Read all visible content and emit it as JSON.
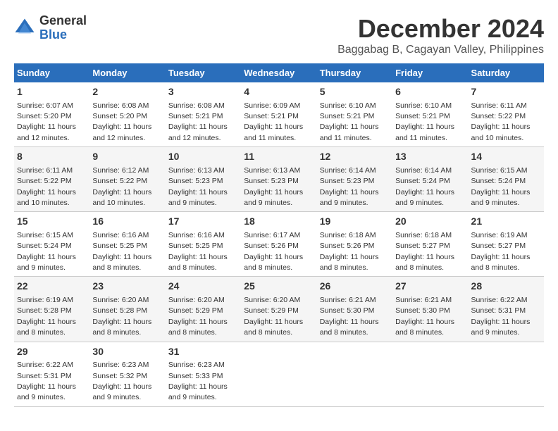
{
  "logo": {
    "general": "General",
    "blue": "Blue"
  },
  "title": "December 2024",
  "subtitle": "Baggabag B, Cagayan Valley, Philippines",
  "days": [
    "Sunday",
    "Monday",
    "Tuesday",
    "Wednesday",
    "Thursday",
    "Friday",
    "Saturday"
  ],
  "weeks": [
    [
      {
        "day": "1",
        "sunrise": "Sunrise: 6:07 AM",
        "sunset": "Sunset: 5:20 PM",
        "daylight": "Daylight: 11 hours and 12 minutes."
      },
      {
        "day": "2",
        "sunrise": "Sunrise: 6:08 AM",
        "sunset": "Sunset: 5:20 PM",
        "daylight": "Daylight: 11 hours and 12 minutes."
      },
      {
        "day": "3",
        "sunrise": "Sunrise: 6:08 AM",
        "sunset": "Sunset: 5:21 PM",
        "daylight": "Daylight: 11 hours and 12 minutes."
      },
      {
        "day": "4",
        "sunrise": "Sunrise: 6:09 AM",
        "sunset": "Sunset: 5:21 PM",
        "daylight": "Daylight: 11 hours and 11 minutes."
      },
      {
        "day": "5",
        "sunrise": "Sunrise: 6:10 AM",
        "sunset": "Sunset: 5:21 PM",
        "daylight": "Daylight: 11 hours and 11 minutes."
      },
      {
        "day": "6",
        "sunrise": "Sunrise: 6:10 AM",
        "sunset": "Sunset: 5:21 PM",
        "daylight": "Daylight: 11 hours and 11 minutes."
      },
      {
        "day": "7",
        "sunrise": "Sunrise: 6:11 AM",
        "sunset": "Sunset: 5:22 PM",
        "daylight": "Daylight: 11 hours and 10 minutes."
      }
    ],
    [
      {
        "day": "8",
        "sunrise": "Sunrise: 6:11 AM",
        "sunset": "Sunset: 5:22 PM",
        "daylight": "Daylight: 11 hours and 10 minutes."
      },
      {
        "day": "9",
        "sunrise": "Sunrise: 6:12 AM",
        "sunset": "Sunset: 5:22 PM",
        "daylight": "Daylight: 11 hours and 10 minutes."
      },
      {
        "day": "10",
        "sunrise": "Sunrise: 6:13 AM",
        "sunset": "Sunset: 5:23 PM",
        "daylight": "Daylight: 11 hours and 9 minutes."
      },
      {
        "day": "11",
        "sunrise": "Sunrise: 6:13 AM",
        "sunset": "Sunset: 5:23 PM",
        "daylight": "Daylight: 11 hours and 9 minutes."
      },
      {
        "day": "12",
        "sunrise": "Sunrise: 6:14 AM",
        "sunset": "Sunset: 5:23 PM",
        "daylight": "Daylight: 11 hours and 9 minutes."
      },
      {
        "day": "13",
        "sunrise": "Sunrise: 6:14 AM",
        "sunset": "Sunset: 5:24 PM",
        "daylight": "Daylight: 11 hours and 9 minutes."
      },
      {
        "day": "14",
        "sunrise": "Sunrise: 6:15 AM",
        "sunset": "Sunset: 5:24 PM",
        "daylight": "Daylight: 11 hours and 9 minutes."
      }
    ],
    [
      {
        "day": "15",
        "sunrise": "Sunrise: 6:15 AM",
        "sunset": "Sunset: 5:24 PM",
        "daylight": "Daylight: 11 hours and 9 minutes."
      },
      {
        "day": "16",
        "sunrise": "Sunrise: 6:16 AM",
        "sunset": "Sunset: 5:25 PM",
        "daylight": "Daylight: 11 hours and 8 minutes."
      },
      {
        "day": "17",
        "sunrise": "Sunrise: 6:16 AM",
        "sunset": "Sunset: 5:25 PM",
        "daylight": "Daylight: 11 hours and 8 minutes."
      },
      {
        "day": "18",
        "sunrise": "Sunrise: 6:17 AM",
        "sunset": "Sunset: 5:26 PM",
        "daylight": "Daylight: 11 hours and 8 minutes."
      },
      {
        "day": "19",
        "sunrise": "Sunrise: 6:18 AM",
        "sunset": "Sunset: 5:26 PM",
        "daylight": "Daylight: 11 hours and 8 minutes."
      },
      {
        "day": "20",
        "sunrise": "Sunrise: 6:18 AM",
        "sunset": "Sunset: 5:27 PM",
        "daylight": "Daylight: 11 hours and 8 minutes."
      },
      {
        "day": "21",
        "sunrise": "Sunrise: 6:19 AM",
        "sunset": "Sunset: 5:27 PM",
        "daylight": "Daylight: 11 hours and 8 minutes."
      }
    ],
    [
      {
        "day": "22",
        "sunrise": "Sunrise: 6:19 AM",
        "sunset": "Sunset: 5:28 PM",
        "daylight": "Daylight: 11 hours and 8 minutes."
      },
      {
        "day": "23",
        "sunrise": "Sunrise: 6:20 AM",
        "sunset": "Sunset: 5:28 PM",
        "daylight": "Daylight: 11 hours and 8 minutes."
      },
      {
        "day": "24",
        "sunrise": "Sunrise: 6:20 AM",
        "sunset": "Sunset: 5:29 PM",
        "daylight": "Daylight: 11 hours and 8 minutes."
      },
      {
        "day": "25",
        "sunrise": "Sunrise: 6:20 AM",
        "sunset": "Sunset: 5:29 PM",
        "daylight": "Daylight: 11 hours and 8 minutes."
      },
      {
        "day": "26",
        "sunrise": "Sunrise: 6:21 AM",
        "sunset": "Sunset: 5:30 PM",
        "daylight": "Daylight: 11 hours and 8 minutes."
      },
      {
        "day": "27",
        "sunrise": "Sunrise: 6:21 AM",
        "sunset": "Sunset: 5:30 PM",
        "daylight": "Daylight: 11 hours and 8 minutes."
      },
      {
        "day": "28",
        "sunrise": "Sunrise: 6:22 AM",
        "sunset": "Sunset: 5:31 PM",
        "daylight": "Daylight: 11 hours and 9 minutes."
      }
    ],
    [
      {
        "day": "29",
        "sunrise": "Sunrise: 6:22 AM",
        "sunset": "Sunset: 5:31 PM",
        "daylight": "Daylight: 11 hours and 9 minutes."
      },
      {
        "day": "30",
        "sunrise": "Sunrise: 6:23 AM",
        "sunset": "Sunset: 5:32 PM",
        "daylight": "Daylight: 11 hours and 9 minutes."
      },
      {
        "day": "31",
        "sunrise": "Sunrise: 6:23 AM",
        "sunset": "Sunset: 5:33 PM",
        "daylight": "Daylight: 11 hours and 9 minutes."
      },
      null,
      null,
      null,
      null
    ]
  ]
}
